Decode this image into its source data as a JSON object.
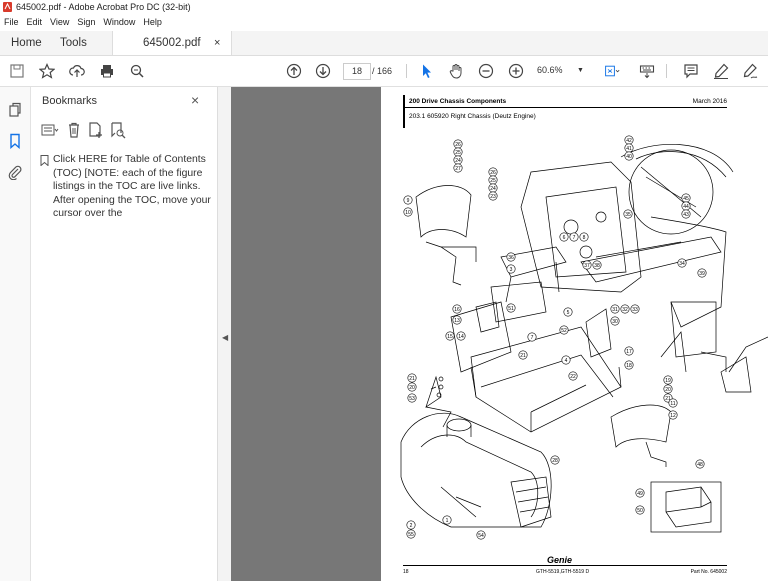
{
  "window": {
    "title": "645002.pdf - Adobe Acrobat Pro DC (32-bit)"
  },
  "menu": [
    "File",
    "Edit",
    "View",
    "Sign",
    "Window",
    "Help"
  ],
  "tabs": {
    "home": "Home",
    "tools": "Tools",
    "doc": "645002.pdf",
    "close": "×"
  },
  "toolbar": {
    "page_current": "18",
    "page_total": "/ 166",
    "zoom": "60.6%"
  },
  "bookmarks": {
    "title": "Bookmarks",
    "close": "×",
    "item": "Click HERE for Table of Contents (TOC) [NOTE: each of the figure listings in the TOC are live links. After opening the TOC, move your cursor over the"
  },
  "page": {
    "section": "200 Drive Chassis Components",
    "date": "March 2016",
    "subtitle": "203.1 605920 Right Chassis (Deutz Engine)",
    "footer_left": "18",
    "footer_mid": "GTH-5519,GTH-5519 D",
    "footer_right": "Part No. 645002",
    "logo": "Genie",
    "callouts": [
      "26",
      "25",
      "24",
      "27",
      "26",
      "25",
      "24",
      "23",
      "9",
      "10",
      "42",
      "41",
      "40",
      "45",
      "44",
      "43",
      "35",
      "6",
      "7",
      "8",
      "36",
      "3",
      "37",
      "38",
      "34",
      "39",
      "16",
      "13",
      "15",
      "14",
      "51",
      "5",
      "52",
      "7",
      "31",
      "32",
      "33",
      "30",
      "17",
      "18",
      "21",
      "4",
      "21",
      "20",
      "53",
      "22",
      "19",
      "20",
      "21",
      "11",
      "12",
      "28",
      "48",
      "49",
      "50",
      "2",
      "55",
      "1",
      "54"
    ]
  }
}
